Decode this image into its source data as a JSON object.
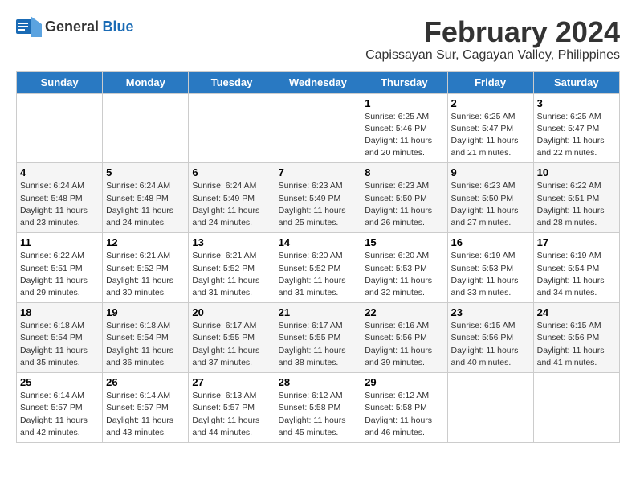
{
  "logo": {
    "general": "General",
    "blue": "Blue"
  },
  "title": "February 2024",
  "subtitle": "Capissayan Sur, Cagayan Valley, Philippines",
  "days_header": [
    "Sunday",
    "Monday",
    "Tuesday",
    "Wednesday",
    "Thursday",
    "Friday",
    "Saturday"
  ],
  "weeks": [
    [
      {
        "day": "",
        "info": ""
      },
      {
        "day": "",
        "info": ""
      },
      {
        "day": "",
        "info": ""
      },
      {
        "day": "",
        "info": ""
      },
      {
        "day": "1",
        "info": "Sunrise: 6:25 AM\nSunset: 5:46 PM\nDaylight: 11 hours\nand 20 minutes."
      },
      {
        "day": "2",
        "info": "Sunrise: 6:25 AM\nSunset: 5:47 PM\nDaylight: 11 hours\nand 21 minutes."
      },
      {
        "day": "3",
        "info": "Sunrise: 6:25 AM\nSunset: 5:47 PM\nDaylight: 11 hours\nand 22 minutes."
      }
    ],
    [
      {
        "day": "4",
        "info": "Sunrise: 6:24 AM\nSunset: 5:48 PM\nDaylight: 11 hours\nand 23 minutes."
      },
      {
        "day": "5",
        "info": "Sunrise: 6:24 AM\nSunset: 5:48 PM\nDaylight: 11 hours\nand 24 minutes."
      },
      {
        "day": "6",
        "info": "Sunrise: 6:24 AM\nSunset: 5:49 PM\nDaylight: 11 hours\nand 24 minutes."
      },
      {
        "day": "7",
        "info": "Sunrise: 6:23 AM\nSunset: 5:49 PM\nDaylight: 11 hours\nand 25 minutes."
      },
      {
        "day": "8",
        "info": "Sunrise: 6:23 AM\nSunset: 5:50 PM\nDaylight: 11 hours\nand 26 minutes."
      },
      {
        "day": "9",
        "info": "Sunrise: 6:23 AM\nSunset: 5:50 PM\nDaylight: 11 hours\nand 27 minutes."
      },
      {
        "day": "10",
        "info": "Sunrise: 6:22 AM\nSunset: 5:51 PM\nDaylight: 11 hours\nand 28 minutes."
      }
    ],
    [
      {
        "day": "11",
        "info": "Sunrise: 6:22 AM\nSunset: 5:51 PM\nDaylight: 11 hours\nand 29 minutes."
      },
      {
        "day": "12",
        "info": "Sunrise: 6:21 AM\nSunset: 5:52 PM\nDaylight: 11 hours\nand 30 minutes."
      },
      {
        "day": "13",
        "info": "Sunrise: 6:21 AM\nSunset: 5:52 PM\nDaylight: 11 hours\nand 31 minutes."
      },
      {
        "day": "14",
        "info": "Sunrise: 6:20 AM\nSunset: 5:52 PM\nDaylight: 11 hours\nand 31 minutes."
      },
      {
        "day": "15",
        "info": "Sunrise: 6:20 AM\nSunset: 5:53 PM\nDaylight: 11 hours\nand 32 minutes."
      },
      {
        "day": "16",
        "info": "Sunrise: 6:19 AM\nSunset: 5:53 PM\nDaylight: 11 hours\nand 33 minutes."
      },
      {
        "day": "17",
        "info": "Sunrise: 6:19 AM\nSunset: 5:54 PM\nDaylight: 11 hours\nand 34 minutes."
      }
    ],
    [
      {
        "day": "18",
        "info": "Sunrise: 6:18 AM\nSunset: 5:54 PM\nDaylight: 11 hours\nand 35 minutes."
      },
      {
        "day": "19",
        "info": "Sunrise: 6:18 AM\nSunset: 5:54 PM\nDaylight: 11 hours\nand 36 minutes."
      },
      {
        "day": "20",
        "info": "Sunrise: 6:17 AM\nSunset: 5:55 PM\nDaylight: 11 hours\nand 37 minutes."
      },
      {
        "day": "21",
        "info": "Sunrise: 6:17 AM\nSunset: 5:55 PM\nDaylight: 11 hours\nand 38 minutes."
      },
      {
        "day": "22",
        "info": "Sunrise: 6:16 AM\nSunset: 5:56 PM\nDaylight: 11 hours\nand 39 minutes."
      },
      {
        "day": "23",
        "info": "Sunrise: 6:15 AM\nSunset: 5:56 PM\nDaylight: 11 hours\nand 40 minutes."
      },
      {
        "day": "24",
        "info": "Sunrise: 6:15 AM\nSunset: 5:56 PM\nDaylight: 11 hours\nand 41 minutes."
      }
    ],
    [
      {
        "day": "25",
        "info": "Sunrise: 6:14 AM\nSunset: 5:57 PM\nDaylight: 11 hours\nand 42 minutes."
      },
      {
        "day": "26",
        "info": "Sunrise: 6:14 AM\nSunset: 5:57 PM\nDaylight: 11 hours\nand 43 minutes."
      },
      {
        "day": "27",
        "info": "Sunrise: 6:13 AM\nSunset: 5:57 PM\nDaylight: 11 hours\nand 44 minutes."
      },
      {
        "day": "28",
        "info": "Sunrise: 6:12 AM\nSunset: 5:58 PM\nDaylight: 11 hours\nand 45 minutes."
      },
      {
        "day": "29",
        "info": "Sunrise: 6:12 AM\nSunset: 5:58 PM\nDaylight: 11 hours\nand 46 minutes."
      },
      {
        "day": "",
        "info": ""
      },
      {
        "day": "",
        "info": ""
      }
    ]
  ]
}
